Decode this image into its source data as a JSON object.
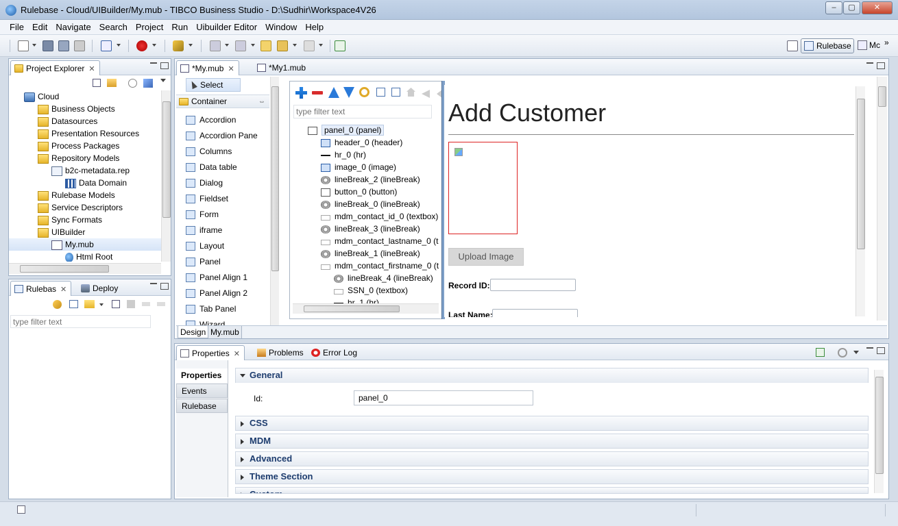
{
  "window": {
    "title": "Rulebase - Cloud/UIBuilder/My.mub - TIBCO Business Studio - D:\\Sudhir\\Workspace4V26"
  },
  "menu": [
    "File",
    "Edit",
    "Navigate",
    "Search",
    "Project",
    "Run",
    "Uibuilder Editor",
    "Window",
    "Help"
  ],
  "perspectives": {
    "active": "Rulebase",
    "other": "Mc",
    "overflow": "»"
  },
  "project_explorer": {
    "tab": "Project Explorer",
    "items": [
      {
        "label": "Cloud",
        "indent": 0,
        "icon": "project-icon"
      },
      {
        "label": "Business Objects",
        "indent": 1,
        "icon": "folder-icon"
      },
      {
        "label": "Datasources",
        "indent": 1,
        "icon": "folder-icon"
      },
      {
        "label": "Presentation Resources",
        "indent": 1,
        "icon": "folder-icon"
      },
      {
        "label": "Process Packages",
        "indent": 1,
        "icon": "folder-icon"
      },
      {
        "label": "Repository Models",
        "indent": 1,
        "icon": "folder-icon"
      },
      {
        "label": "b2c-metadata.rep",
        "indent": 2,
        "icon": "file-icon"
      },
      {
        "label": "Data Domain",
        "indent": 3,
        "icon": "domain-icon"
      },
      {
        "label": "Rulebase Models",
        "indent": 1,
        "icon": "folder-icon"
      },
      {
        "label": "Service Descriptors",
        "indent": 1,
        "icon": "folder-icon"
      },
      {
        "label": "Sync Formats",
        "indent": 1,
        "icon": "folder-icon"
      },
      {
        "label": "UIBuilder",
        "indent": 1,
        "icon": "folder-icon"
      },
      {
        "label": "My.mub",
        "indent": 2,
        "icon": "mub-file-icon"
      },
      {
        "label": "Html Root",
        "indent": 3,
        "icon": "globe-icon"
      }
    ]
  },
  "rulebas_view": {
    "tabs": [
      "Rulebas",
      "Deploy"
    ],
    "filter_placeholder": "type filter text"
  },
  "editor": {
    "tabs": [
      "*My.mub",
      "*My1.mub"
    ],
    "palette": {
      "select": "Select",
      "group": "Container",
      "items": [
        "Accordion",
        "Accordion Pane",
        "Columns",
        "Data table",
        "Dialog",
        "Fieldset",
        "Form",
        "iframe",
        "Layout",
        "Panel",
        "Panel Align 1",
        "Panel Align 2",
        "Tab Panel",
        "Wizard"
      ]
    },
    "outline": {
      "filter_placeholder": "type filter text",
      "rows": [
        {
          "label": "panel_0 (panel)",
          "indent": 0,
          "icon": "panel-icon"
        },
        {
          "label": "header_0 (header)",
          "indent": 1,
          "icon": "header-icon"
        },
        {
          "label": "hr_0 (hr)",
          "indent": 1,
          "icon": "hr-icon"
        },
        {
          "label": "image_0 (image)",
          "indent": 1,
          "icon": "image-icon"
        },
        {
          "label": "lineBreak_2 (lineBreak)",
          "indent": 1,
          "icon": "gear-icon"
        },
        {
          "label": "button_0 (button)",
          "indent": 1,
          "icon": "button-icon"
        },
        {
          "label": "lineBreak_0 (lineBreak)",
          "indent": 1,
          "icon": "gear-icon"
        },
        {
          "label": "mdm_contact_id_0 (textbox)",
          "indent": 1,
          "icon": "textbox-icon"
        },
        {
          "label": "lineBreak_3 (lineBreak)",
          "indent": 1,
          "icon": "gear-icon"
        },
        {
          "label": "mdm_contact_lastname_0 (t",
          "indent": 1,
          "icon": "textbox-icon"
        },
        {
          "label": "lineBreak_1 (lineBreak)",
          "indent": 1,
          "icon": "gear-icon"
        },
        {
          "label": "mdm_contact_firstname_0 (t",
          "indent": 1,
          "icon": "textbox-icon"
        },
        {
          "label": "lineBreak_4 (lineBreak)",
          "indent": 2,
          "icon": "gear-icon"
        },
        {
          "label": "SSN_0 (textbox)",
          "indent": 2,
          "icon": "textbox-icon"
        },
        {
          "label": "hr_1 (hr)",
          "indent": 2,
          "icon": "hr-icon"
        }
      ]
    },
    "canvas": {
      "heading": "Add Customer",
      "upload_button": "Upload Image",
      "record_id_label": "Record ID:",
      "last_name_label": "Last Name:"
    },
    "bottom_tabs": [
      "Design",
      "My.mub"
    ]
  },
  "properties": {
    "tabs": [
      "Properties",
      "Problems",
      "Error Log"
    ],
    "side_tabs": [
      "Properties",
      "Events",
      "Rulebase"
    ],
    "sections": [
      "General",
      "CSS",
      "MDM",
      "Advanced",
      "Theme Section",
      "Custom"
    ],
    "id_label": "Id:",
    "id_value": "panel_0"
  }
}
